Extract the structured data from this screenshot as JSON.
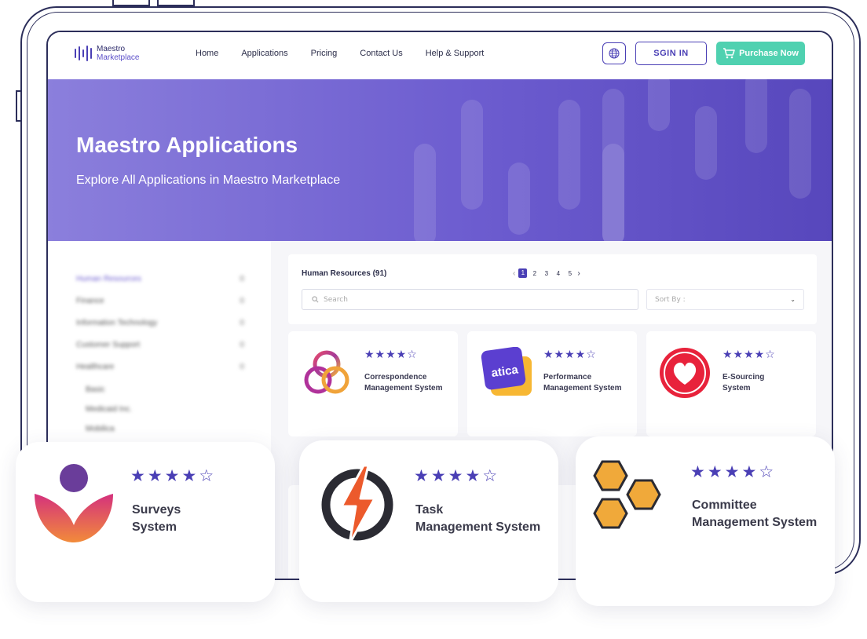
{
  "header": {
    "logo_line1": "Maestro",
    "logo_line2": "Marketplace",
    "nav": [
      "Home",
      "Applications",
      "Pricing",
      "Contact Us",
      "Help & Support"
    ],
    "signin_label": "SGIN IN",
    "purchase_label": "Purchase Now"
  },
  "hero": {
    "title": "Maestro Applications",
    "subtitle": "Explore All Applications in Maestro Marketplace"
  },
  "sidebar": {
    "items": [
      {
        "label": "Human Resources",
        "count": "0"
      },
      {
        "label": "Finance",
        "count": "0"
      },
      {
        "label": "Information Technology",
        "count": "0"
      },
      {
        "label": "Customer Support",
        "count": "0"
      },
      {
        "label": "Healthcare",
        "count": "0"
      }
    ],
    "sub_items": [
      "Basic",
      "Medicaid Inc.",
      "Mobilica"
    ]
  },
  "listing": {
    "category_label": "Human Resources (91)",
    "pages": [
      "1",
      "2",
      "3",
      "4",
      "5"
    ],
    "active_page": "1",
    "search_placeholder": "Search",
    "sort_placeholder": "Sort By :"
  },
  "apps": [
    {
      "name_line1": "Correspondence",
      "name_line2": "Management System",
      "rating": 4,
      "icon": "triquetra-icon"
    },
    {
      "name_line1": "Performance",
      "name_line2": "Management System",
      "rating": 4,
      "icon": "atica-logo-icon",
      "logo_text": "atica"
    },
    {
      "name_line1": "E-Sourcing",
      "name_line2": "System",
      "rating": 4,
      "icon": "heart-icon"
    }
  ],
  "featured": [
    {
      "name_line1": "Surveys",
      "name_line2": "System",
      "rating": 4,
      "icon": "lotus-person-icon"
    },
    {
      "name_line1": "Task",
      "name_line2": "Management System",
      "rating": 4,
      "icon": "lightning-icon"
    },
    {
      "name_line1": "Committee",
      "name_line2": "Management System",
      "rating": 4,
      "icon": "honeycomb-icon"
    }
  ],
  "colors": {
    "accent": "#4a3fb5",
    "purchase": "#4fd1b0",
    "hero_start": "#8b7fdc",
    "hero_end": "#5747bc"
  }
}
